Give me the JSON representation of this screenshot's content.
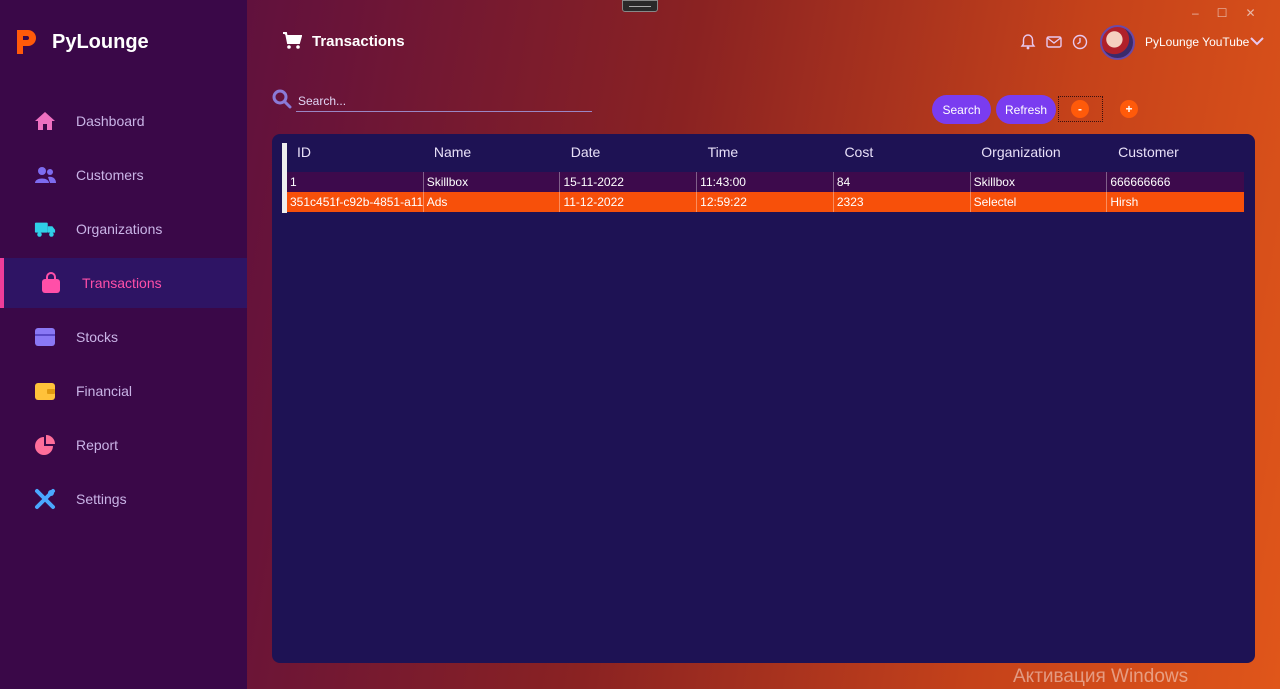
{
  "app": {
    "name": "PyLounge",
    "window_controls": [
      "–",
      "☐",
      "✕"
    ]
  },
  "sidebar": {
    "items": [
      {
        "label": "Dashboard",
        "icon": "home-icon"
      },
      {
        "label": "Customers",
        "icon": "users-icon"
      },
      {
        "label": "Organizations",
        "icon": "truck-icon"
      },
      {
        "label": "Transactions",
        "icon": "shopping-bag-icon",
        "active": true
      },
      {
        "label": "Stocks",
        "icon": "box-icon"
      },
      {
        "label": "Financial",
        "icon": "wallet-icon"
      },
      {
        "label": "Report",
        "icon": "pie-chart-icon"
      },
      {
        "label": "Settings",
        "icon": "tools-icon"
      }
    ]
  },
  "header": {
    "title": "Transactions",
    "title_icon": "cart-icon",
    "user_name": "PyLounge YouTube"
  },
  "search": {
    "placeholder": "Search...",
    "value": ""
  },
  "toolbar": {
    "search_label": "Search",
    "refresh_label": "Refresh",
    "remove_label": "-",
    "add_label": "+"
  },
  "table": {
    "columns": [
      "ID",
      "Name",
      "Date",
      "Time",
      "Cost",
      "Organization",
      "Customer"
    ],
    "rows": [
      [
        "1",
        "Skillbox",
        "15-11-2022",
        "11:43:00",
        "84",
        "Skillbox",
        "666666666"
      ],
      [
        "351c451f-c92b-4851-a11",
        "Ads",
        "11-12-2022",
        "12:59:22",
        "2323",
        "Selectel",
        "Hirsh"
      ]
    ]
  },
  "watermark": "Активация Windows",
  "colors": {
    "accent": "#7a3cf0",
    "active_nav": "#ff4fa8",
    "selected_row": "#f7500a",
    "panel": "#1e1254"
  }
}
